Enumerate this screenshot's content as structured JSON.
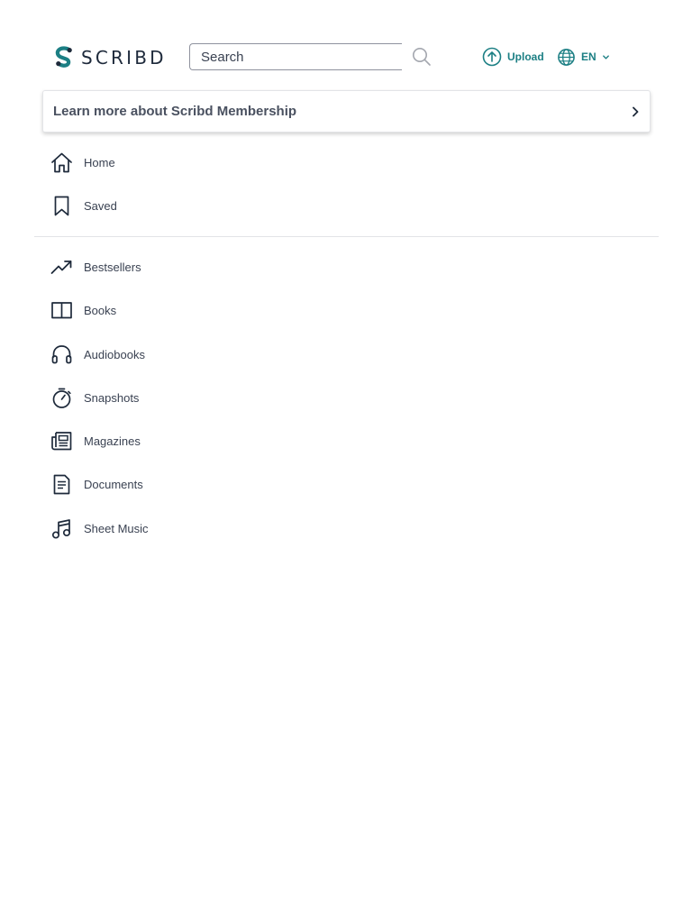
{
  "header": {
    "logo_text": "SCRIBD",
    "search": {
      "placeholder": "Search",
      "value": ""
    },
    "upload_label": "Upload",
    "language_label": "EN"
  },
  "membership_banner": {
    "label": "Learn more about Scribd Membership"
  },
  "nav": {
    "primary": [
      {
        "label": "Home",
        "icon": "home-icon"
      },
      {
        "label": "Saved",
        "icon": "bookmark-icon"
      }
    ],
    "categories": [
      {
        "label": "Bestsellers",
        "icon": "trending-up-icon"
      },
      {
        "label": "Books",
        "icon": "book-icon"
      },
      {
        "label": "Audiobooks",
        "icon": "headphones-icon"
      },
      {
        "label": "Snapshots",
        "icon": "stopwatch-icon"
      },
      {
        "label": "Magazines",
        "icon": "magazine-icon"
      },
      {
        "label": "Documents",
        "icon": "document-icon"
      },
      {
        "label": "Sheet Music",
        "icon": "music-note-icon"
      }
    ]
  },
  "colors": {
    "accent": "#1c7f84",
    "icon": "#1e2a3b",
    "text": "#3a4252",
    "divider": "#e3e4e7"
  }
}
